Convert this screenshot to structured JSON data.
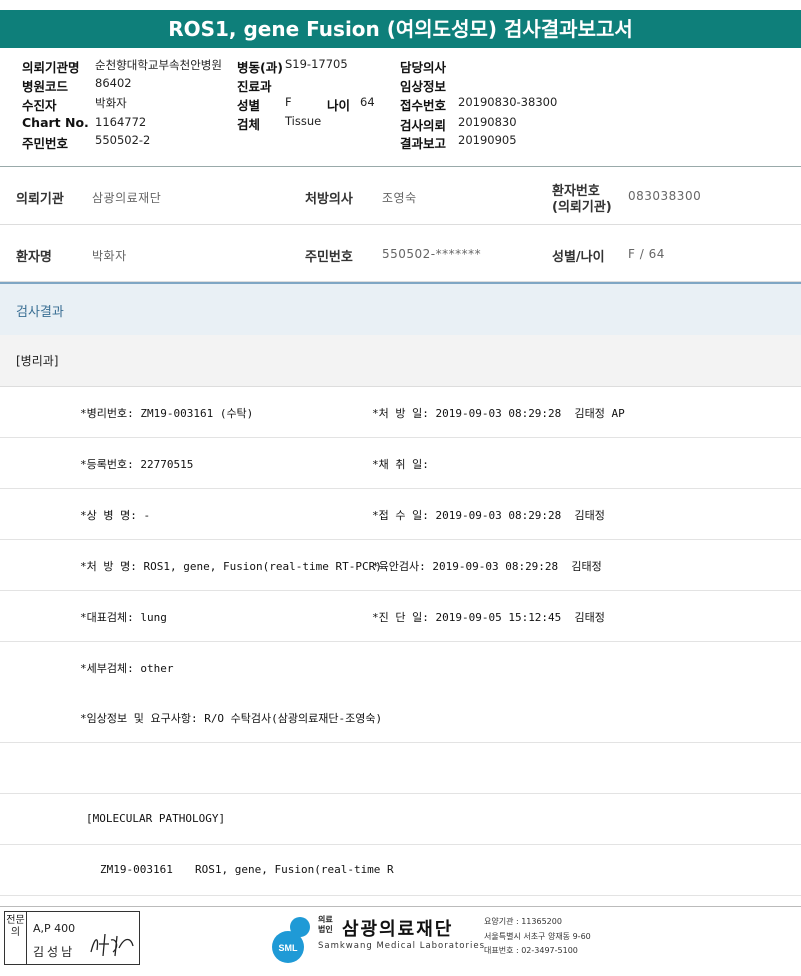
{
  "report_title": "ROS1, gene Fusion (여의도성모) 검사결과보고서",
  "header": {
    "requesting_institution_label": "의뢰기관명",
    "requesting_institution_value": "순천향대학교부속천안병원",
    "ward_label": "병동(과)",
    "ward_value": "S19-17705",
    "attending_label": "담당의사",
    "hospital_code_label": "병원코드",
    "hospital_code_value": "86402",
    "department_label": "진료과",
    "clinical_info_label": "임상정보",
    "examinee_label": "수진자",
    "examinee_value": "박화자",
    "sex_label": "성별",
    "sex_value": "F",
    "age_label": "나이",
    "age_value": "64",
    "receipt_no_label": "접수번호",
    "receipt_no_value": "20190830-38300",
    "chart_no_label": "Chart No.",
    "chart_no_value": "1164772",
    "specimen_label": "검체",
    "specimen_value": "Tissue",
    "request_date_label": "검사의뢰",
    "request_date_value": "20190830",
    "id_no_label": "주민번호",
    "id_no_value": "550502-2",
    "report_date_label": "결과보고",
    "report_date_value": "20190905"
  },
  "patient_table": {
    "institution_label": "의뢰기관",
    "institution_value": "삼광의료재단",
    "doctor_label": "처방의사",
    "doctor_value": "조영숙",
    "patient_no_label_line1": "환자번호",
    "patient_no_label_line2": "(의뢰기관)",
    "patient_no_value": "083038300",
    "patient_name_label": "환자명",
    "patient_name_value": "박화자",
    "id_label": "주민번호",
    "id_value": "550502-*******",
    "sex_age_label": "성별/나이",
    "sex_age_value": "F / 64"
  },
  "results": {
    "section_title": "검사결과",
    "department": "[병리과]",
    "rows": [
      {
        "left": "*병리번호: ZM19-003161 (수탁)",
        "right": "*처 방 일: 2019-09-03 08:29:28  김태정 AP"
      },
      {
        "left": "*등록번호: 22770515",
        "right": "*채 취 일:"
      },
      {
        "left": "*상 병 명: -",
        "right": "*접 수 일: 2019-09-03 08:29:28  김태정"
      },
      {
        "left": "*처 방 명: ROS1, gene, Fusion(real-time RT-PCR)",
        "right": "*육안검사: 2019-09-03 08:29:28  김태정"
      },
      {
        "left": "*대표검체: lung",
        "right": "*진 단 일: 2019-09-05 15:12:45  김태정"
      },
      {
        "left": "*세부검체: other",
        "right": ""
      },
      {
        "left": "*임상정보 및 요구사항: R/O 수탁검사(삼광의료재단-조영숙)",
        "right": ""
      }
    ],
    "molecular_header": "[MOLECULAR PATHOLOGY]",
    "molecular_line_id": "ZM19-003161",
    "molecular_line_test": "ROS1, gene, Fusion(real-time R"
  },
  "footer": {
    "sign_side": "전문의",
    "sign_ap": "A,P 400",
    "sign_name": "김성남",
    "logo_badge": "SML",
    "logo_small_line1": "의료",
    "logo_small_line2": "법인",
    "logo_name": "삼광의료재단",
    "logo_en": "Samkwang Medical Laboratories",
    "institution_code": "요양기관 : 11365200",
    "address": "서울특별시 서초구 양재동 9-60",
    "phone": "대표번호 : 02-3497-5100"
  }
}
